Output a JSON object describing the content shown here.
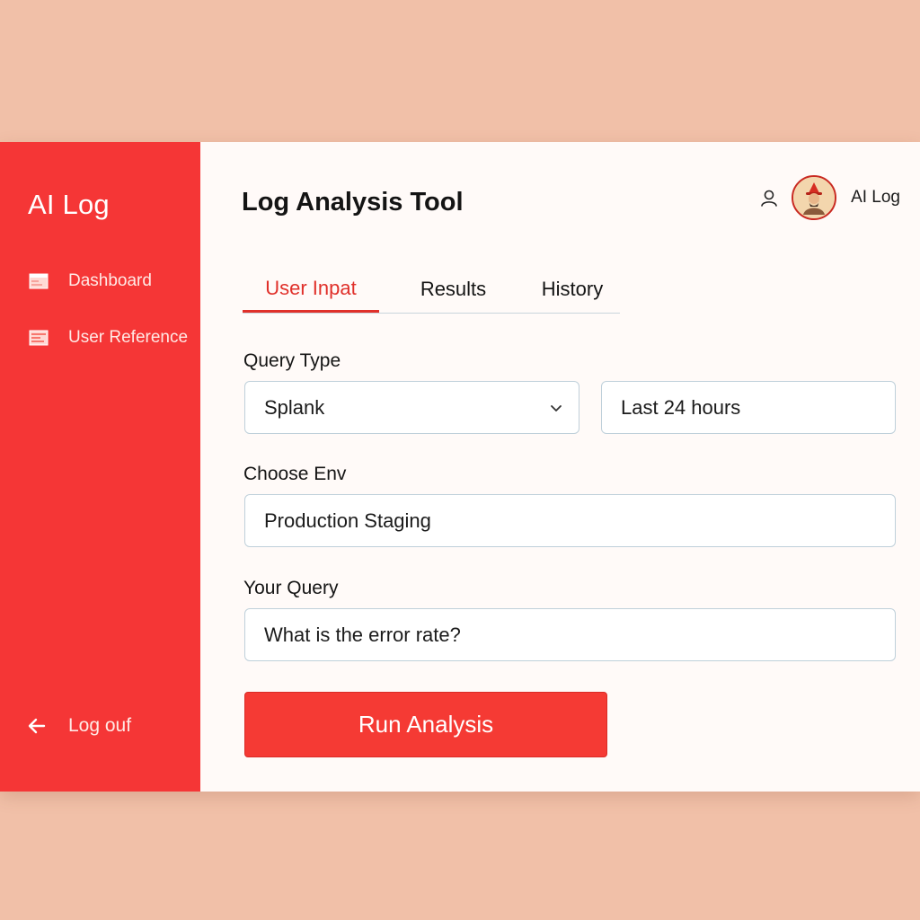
{
  "sidebar": {
    "brand": "AI Log",
    "items": [
      {
        "label": "Dashboard",
        "icon": "window-icon"
      },
      {
        "label": "User Reference",
        "icon": "list-icon"
      }
    ],
    "logout_label": "Log ouf"
  },
  "header": {
    "title": "Log Analysis Tool",
    "user_name": "AI Log"
  },
  "tabs": [
    {
      "label": "User Inpat",
      "active": true
    },
    {
      "label": "Results",
      "active": false
    },
    {
      "label": "History",
      "active": false
    }
  ],
  "form": {
    "query_type_label": "Query Type",
    "query_type_value": "Splank",
    "time_range_value": "Last 24 hours",
    "env_label": "Choose Env",
    "env_value": "Production Staging",
    "query_label": "Your Query",
    "query_value": "What is the error rate?",
    "run_label": "Run Analysis"
  },
  "colors": {
    "accent": "#f53636",
    "page_bg": "#f1c0a8",
    "main_bg": "#fffaf8"
  }
}
